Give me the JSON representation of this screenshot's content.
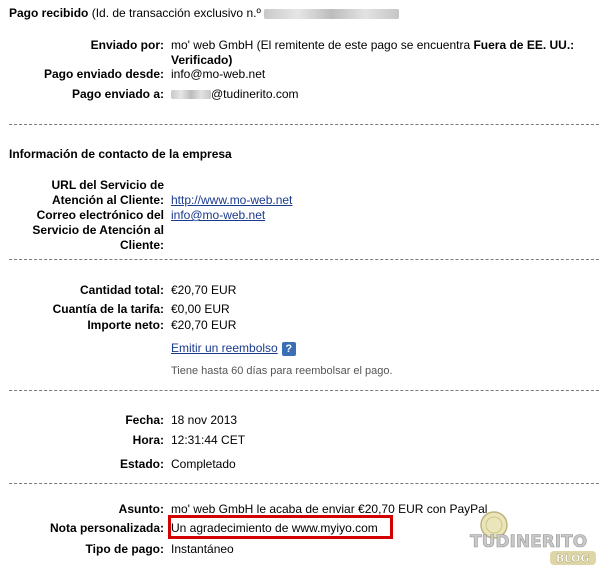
{
  "header": {
    "title": "Pago recibido",
    "transaction_prefix": "(Id. de transacción exclusivo n.º"
  },
  "sender_block": {
    "sent_by_label": "Enviado por:",
    "sent_by_name": "mo' web GmbH",
    "sent_by_note_a": "(El remitente de este pago se encuentra",
    "sent_by_note_bold": "Fuera de EE. UU.: Verificado)",
    "sent_from_label": "Pago enviado desde:",
    "sent_from_value": "info@mo-web.net",
    "sent_to_label": "Pago enviado a:",
    "sent_to_value": "@tudinerito.com"
  },
  "company_contact": {
    "section_title": "Información de contacto de la empresa",
    "service_url_label": "URL del Servicio de Atención al Cliente:",
    "service_url_value": "http://www.mo-web.net",
    "service_email_label": "Correo electrónico del Servicio de Atención al Cliente:",
    "service_email_value": "info@mo-web.net"
  },
  "amounts": {
    "total_label": "Cantidad total:",
    "total_value": "€20,70 EUR",
    "fee_label": "Cuantía de la tarifa:",
    "fee_value": "€0,00 EUR",
    "net_label": "Importe neto:",
    "net_value": "€20,70 EUR",
    "refund_link": "Emitir un reembolso",
    "refund_help": "?",
    "refund_note": "Tiene hasta 60 días para reembolsar el pago."
  },
  "dates": {
    "date_label": "Fecha:",
    "date_value": "18 nov 2013",
    "time_label": "Hora:",
    "time_value": "12:31:44 CET",
    "status_label": "Estado:",
    "status_value": "Completado"
  },
  "details": {
    "subject_label": "Asunto:",
    "subject_value": "mo' web GmbH le acaba de enviar €20,70 EUR con PayPal",
    "note_label": "Nota personalizada:",
    "note_value": "Un agradecimiento de www.myiyo.com",
    "pay_type_label": "Tipo de pago:",
    "pay_type_value": "Instantáneo"
  },
  "watermark": {
    "line1": "TUDINERITO",
    "line2": "BLOG"
  },
  "colors": {
    "link": "#1a3a8c",
    "highlight": "#d40000",
    "help_icon": "#3a6fb5"
  }
}
